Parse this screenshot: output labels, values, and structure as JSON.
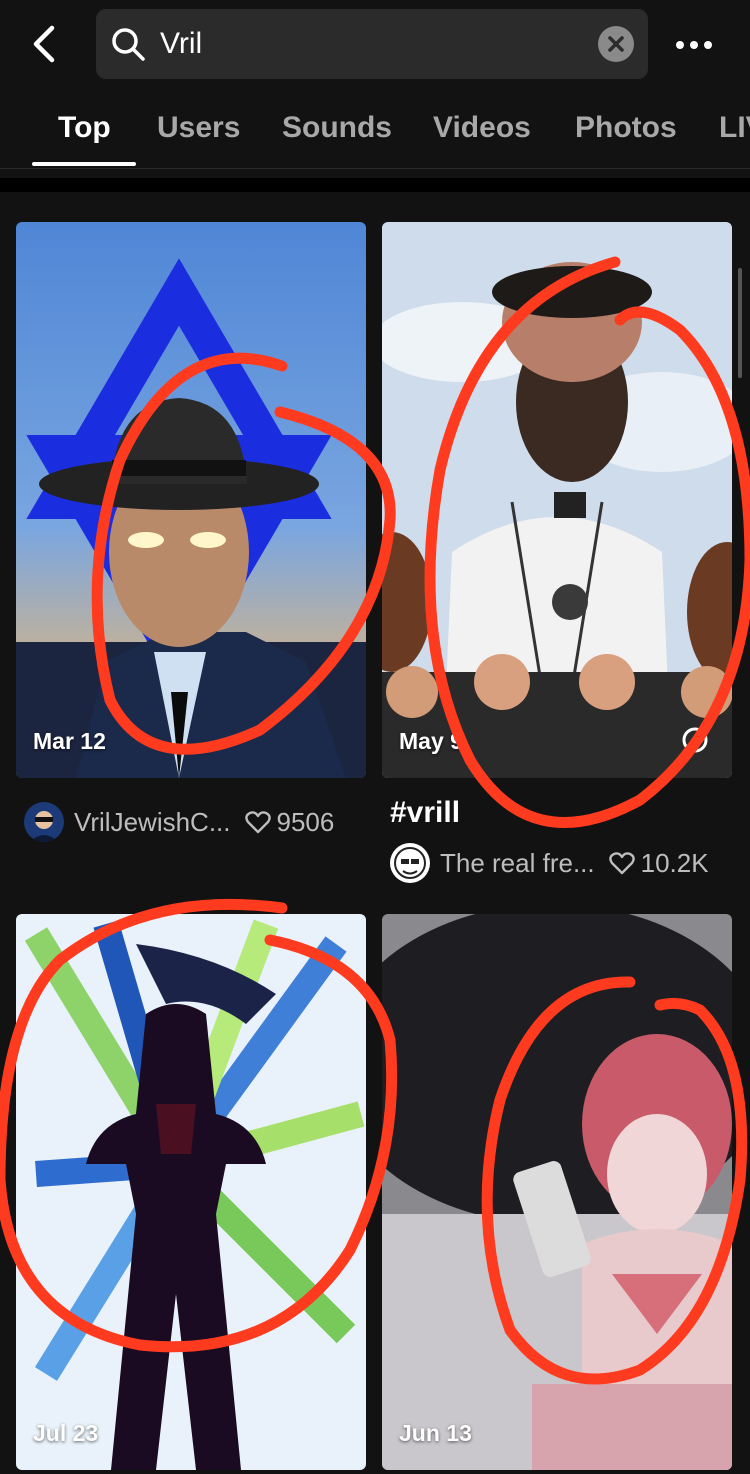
{
  "search": {
    "query": "Vril"
  },
  "tabs": [
    {
      "label": "Top"
    },
    {
      "label": "Users"
    },
    {
      "label": "Sounds"
    },
    {
      "label": "Videos"
    },
    {
      "label": "Photos"
    },
    {
      "label": "LIVE"
    }
  ],
  "results": [
    {
      "date": "Mar 12",
      "caption": "",
      "username": "VrilJewishC...",
      "likes": "9506"
    },
    {
      "date": "May 9",
      "caption": "#vrill",
      "username": "The real fre...",
      "likes": "10.2K"
    },
    {
      "date": "Jul 23",
      "caption": "",
      "username": "",
      "likes": ""
    },
    {
      "date": "Jun 13",
      "caption": "",
      "username": "",
      "likes": ""
    }
  ],
  "colors": {
    "background": "#121212",
    "annotation_red": "#ff3b1f",
    "muted_text": "#bdbdbd"
  },
  "icons": [
    "back-arrow-icon",
    "search-icon",
    "clear-icon",
    "more-options-icon",
    "heart-icon"
  ]
}
